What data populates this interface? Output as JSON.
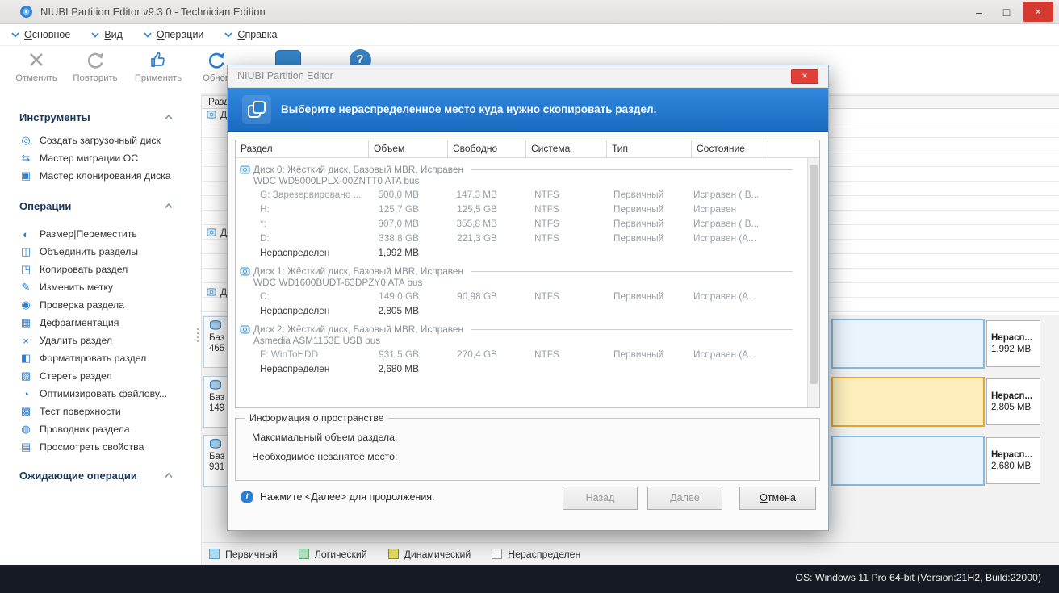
{
  "window": {
    "title": "NIUBI Partition Editor v9.3.0 - Technician Edition"
  },
  "icons": {
    "minimize": "–",
    "maximize": "□",
    "close": "×",
    "dialog_close": "×",
    "help_question": "?",
    "info": "i"
  },
  "menu": {
    "items": [
      {
        "label": "Основное"
      },
      {
        "label": "Вид"
      },
      {
        "label": "Операции"
      },
      {
        "label": "Справка"
      }
    ]
  },
  "toolbar": {
    "items": [
      {
        "label": "Отменить"
      },
      {
        "label": "Повторить"
      },
      {
        "label": "Применить"
      },
      {
        "label": "Обнов"
      }
    ]
  },
  "sidebar": {
    "sections": [
      {
        "title": "Инструменты",
        "items": [
          {
            "icon": "◎",
            "label": "Создать загрузочный диск"
          },
          {
            "icon": "⇆",
            "label": "Мастер миграции ОС"
          },
          {
            "icon": "▣",
            "label": "Мастер клонирования диска"
          }
        ]
      },
      {
        "title": "Операции",
        "items": [
          {
            "icon": "◐",
            "label": "Размер|Переместить"
          },
          {
            "icon": "◫",
            "label": "Объединить разделы"
          },
          {
            "icon": "◳",
            "label": "Копировать раздел"
          },
          {
            "icon": "✎",
            "label": "Изменить метку"
          },
          {
            "icon": "◉",
            "label": "Проверка раздела"
          },
          {
            "icon": "▦",
            "label": "Дефрагментация"
          },
          {
            "icon": "×",
            "label": "Удалить раздел"
          },
          {
            "icon": "◧",
            "label": "Форматировать раздел"
          },
          {
            "icon": "▨",
            "label": "Стереть раздел"
          },
          {
            "icon": "◔",
            "label": "Оптимизировать файлову..."
          },
          {
            "icon": "▩",
            "label": "Тест поверхности"
          },
          {
            "icon": "◍",
            "label": "Проводник раздела"
          },
          {
            "icon": "▤",
            "label": "Просмотреть свойства"
          }
        ]
      },
      {
        "title": "Ожидающие операции",
        "items": []
      }
    ]
  },
  "main": {
    "table_header_fragment": "Разд...",
    "row_fragments": [
      "Д",
      "Д",
      "Д"
    ],
    "disk_blocks": [
      {
        "type": "Баз",
        "size": "465"
      },
      {
        "type": "Баз",
        "size": "149"
      },
      {
        "type": "Баз",
        "size": "931"
      }
    ],
    "map_rows": [
      {
        "unalloc_label": "Нерасп...",
        "unalloc_size": "1,992 MB"
      },
      {
        "unalloc_label": "Нерасп...",
        "unalloc_size": "2,805 MB"
      },
      {
        "unalloc_label": "Нерасп...",
        "unalloc_size": "2,680 MB"
      }
    ]
  },
  "legend": {
    "items": [
      {
        "label": "Первичный",
        "color": "#addbf3",
        "border": "#5d9dc6"
      },
      {
        "label": "Логический",
        "color": "#b5e3c3",
        "border": "#63a877"
      },
      {
        "label": "Динамический",
        "color": "#e4df5f",
        "border": "#8a8a3a"
      },
      {
        "label": "Нераспределен",
        "color": "#ffffff",
        "border": "#9a9a9a"
      }
    ]
  },
  "statusbar": {
    "os_info": "OS: Windows 11 Pro 64-bit (Version:21H2, Build:22000)"
  },
  "dialog": {
    "title": "NIUBI Partition Editor",
    "banner": "Выберите нераспределенное место куда нужно скопировать раздел.",
    "columns": [
      "Раздел",
      "Объем",
      "Свободно",
      "Система",
      "Тип",
      "Состояние"
    ],
    "groups": [
      {
        "disk": "Диск 0: Жёсткий диск, Базовый MBR, Исправен",
        "model": "WDC WD5000LPLX-00ZNTT0 ATA bus",
        "rows": [
          {
            "name": "G: Зарезервировано ...",
            "size": "500,0 MB",
            "free": "147,3 MB",
            "fs": "NTFS",
            "type": "Первичный",
            "status": "Исправен ( В..."
          },
          {
            "name": "H:",
            "size": "125,7 GB",
            "free": "125,5 GB",
            "fs": "NTFS",
            "type": "Первичный",
            "status": "Исправен"
          },
          {
            "name": "*:",
            "size": "807,0 MB",
            "free": "355,8 MB",
            "fs": "NTFS",
            "type": "Первичный",
            "status": "Исправен ( В..."
          },
          {
            "name": "D:",
            "size": "338,8 GB",
            "free": "221,3 GB",
            "fs": "NTFS",
            "type": "Первичный",
            "status": "Исправен (А..."
          },
          {
            "name": "Нераспределен",
            "size": "1,992 MB",
            "free": "",
            "fs": "",
            "type": "",
            "status": ""
          }
        ]
      },
      {
        "disk": "Диск 1: Жёсткий диск, Базовый MBR, Исправен",
        "model": "WDC WD1600BUDT-63DPZY0 ATA bus",
        "rows": [
          {
            "name": "C:",
            "size": "149,0 GB",
            "free": "90,98 GB",
            "fs": "NTFS",
            "type": "Первичный",
            "status": "Исправен (А..."
          },
          {
            "name": "Нераспределен",
            "size": "2,805 MB",
            "free": "",
            "fs": "",
            "type": "",
            "status": ""
          }
        ]
      },
      {
        "disk": "Диск 2: Жёсткий диск, Базовый MBR, Исправен",
        "model": "Asmedia ASM1153E USB bus",
        "rows": [
          {
            "name": "F: WinToHDD",
            "size": "931,5 GB",
            "free": "270,4 GB",
            "fs": "NTFS",
            "type": "Первичный",
            "status": "Исправен (А..."
          },
          {
            "name": "Нераспределен",
            "size": "2,680 MB",
            "free": "",
            "fs": "",
            "type": "",
            "status": ""
          }
        ]
      }
    ],
    "info_box": {
      "title": "Информация о пространстве",
      "line1": "Максимальный объем раздела:",
      "line2": "Необходимое незанятое место:"
    },
    "hint": "Нажмите <Далее> для продолжения.",
    "buttons": {
      "back": "Назад",
      "next": "Далее",
      "cancel": "Отмена"
    }
  }
}
